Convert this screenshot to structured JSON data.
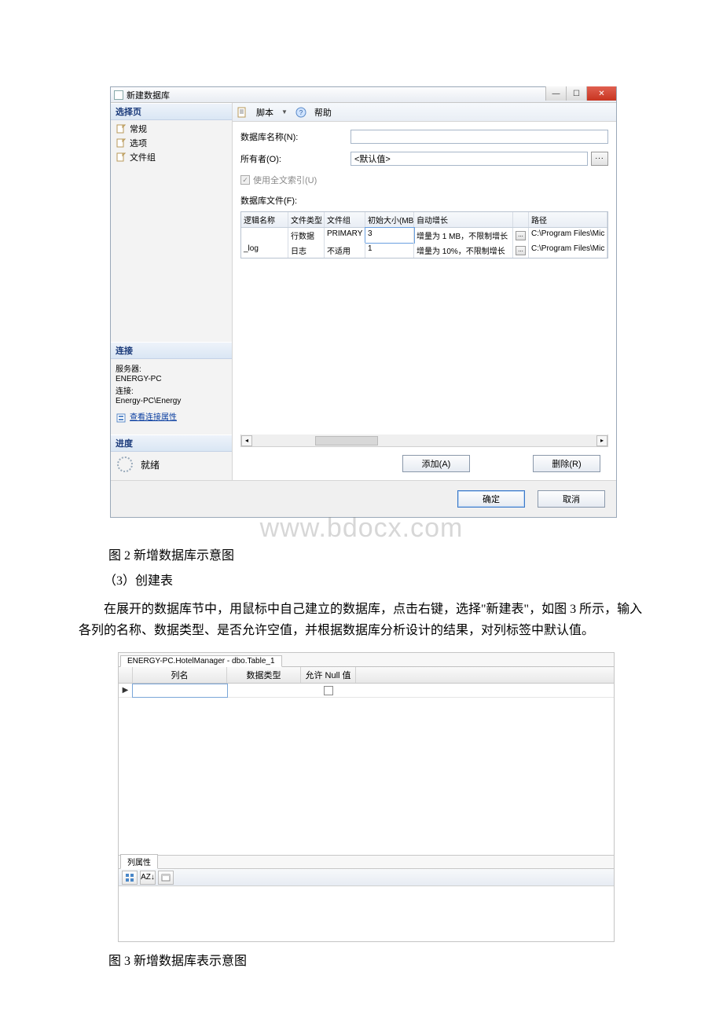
{
  "watermark": "www.bdocx.com",
  "dialog": {
    "title": "新建数据库",
    "winbtns": {
      "min": "—",
      "max": "☐",
      "close": "✕"
    },
    "left": {
      "selectHeader": "选择页",
      "pages": [
        "常规",
        "选项",
        "文件组"
      ],
      "connHeader": "连接",
      "serverLabel": "服务器:",
      "serverValue": "ENERGY-PC",
      "connLabel": "连接:",
      "connValue": "Energy-PC\\Energy",
      "viewConn": "查看连接属性",
      "progressHeader": "进度",
      "progressText": "就绪"
    },
    "toolbar": {
      "script": "脚本",
      "help": "帮助"
    },
    "form": {
      "dbNameLabel": "数据库名称(N):",
      "ownerLabel": "所有者(O):",
      "ownerValue": "<默认值>",
      "fulltextLabel": "使用全文索引(U)",
      "fulltextChecked": "✓",
      "filesLabel": "数据库文件(F):",
      "browse": "..."
    },
    "grid": {
      "headers": [
        "逻辑名称",
        "文件类型",
        "文件组",
        "初始大小(MB)",
        "自动增长",
        "",
        "路径"
      ],
      "rows": [
        {
          "name": "",
          "type": "行数据",
          "group": "PRIMARY",
          "size": "3",
          "growth": "增量为 1 MB，不限制增长",
          "path": "C:\\Program Files\\Mic"
        },
        {
          "name": "_log",
          "type": "日志",
          "group": "不适用",
          "size": "1",
          "growth": "增量为 10%，不限制增长",
          "path": "C:\\Program Files\\Mic"
        }
      ],
      "cellbtn": "..."
    },
    "buttons": {
      "add": "添加(A)",
      "remove": "删除(R)",
      "ok": "确定",
      "cancel": "取消"
    }
  },
  "captions": {
    "fig2": "图 2 新增数据库示意图",
    "fig3": "图 3 新增数据库表示意图"
  },
  "text": {
    "step3": "（3）创建表",
    "para": "在展开的数据库节中，用鼠标中自己建立的数据库，点击右键，选择\"新建表\"，如图 3 所示，输入各列的名称、数据类型、是否允许空值，并根据数据库分析设计的结果，对列标签中默认值。"
  },
  "tableDesigner": {
    "tab": "ENERGY-PC.HotelManager - dbo.Table_1",
    "headers": {
      "col": "列名",
      "type": "数据类型",
      "null": "允许 Null 值"
    },
    "rowMarker": "▶",
    "propTab": "列属性",
    "sortA": "A",
    "sortZ": "Z",
    "sortArrow": "↓"
  }
}
